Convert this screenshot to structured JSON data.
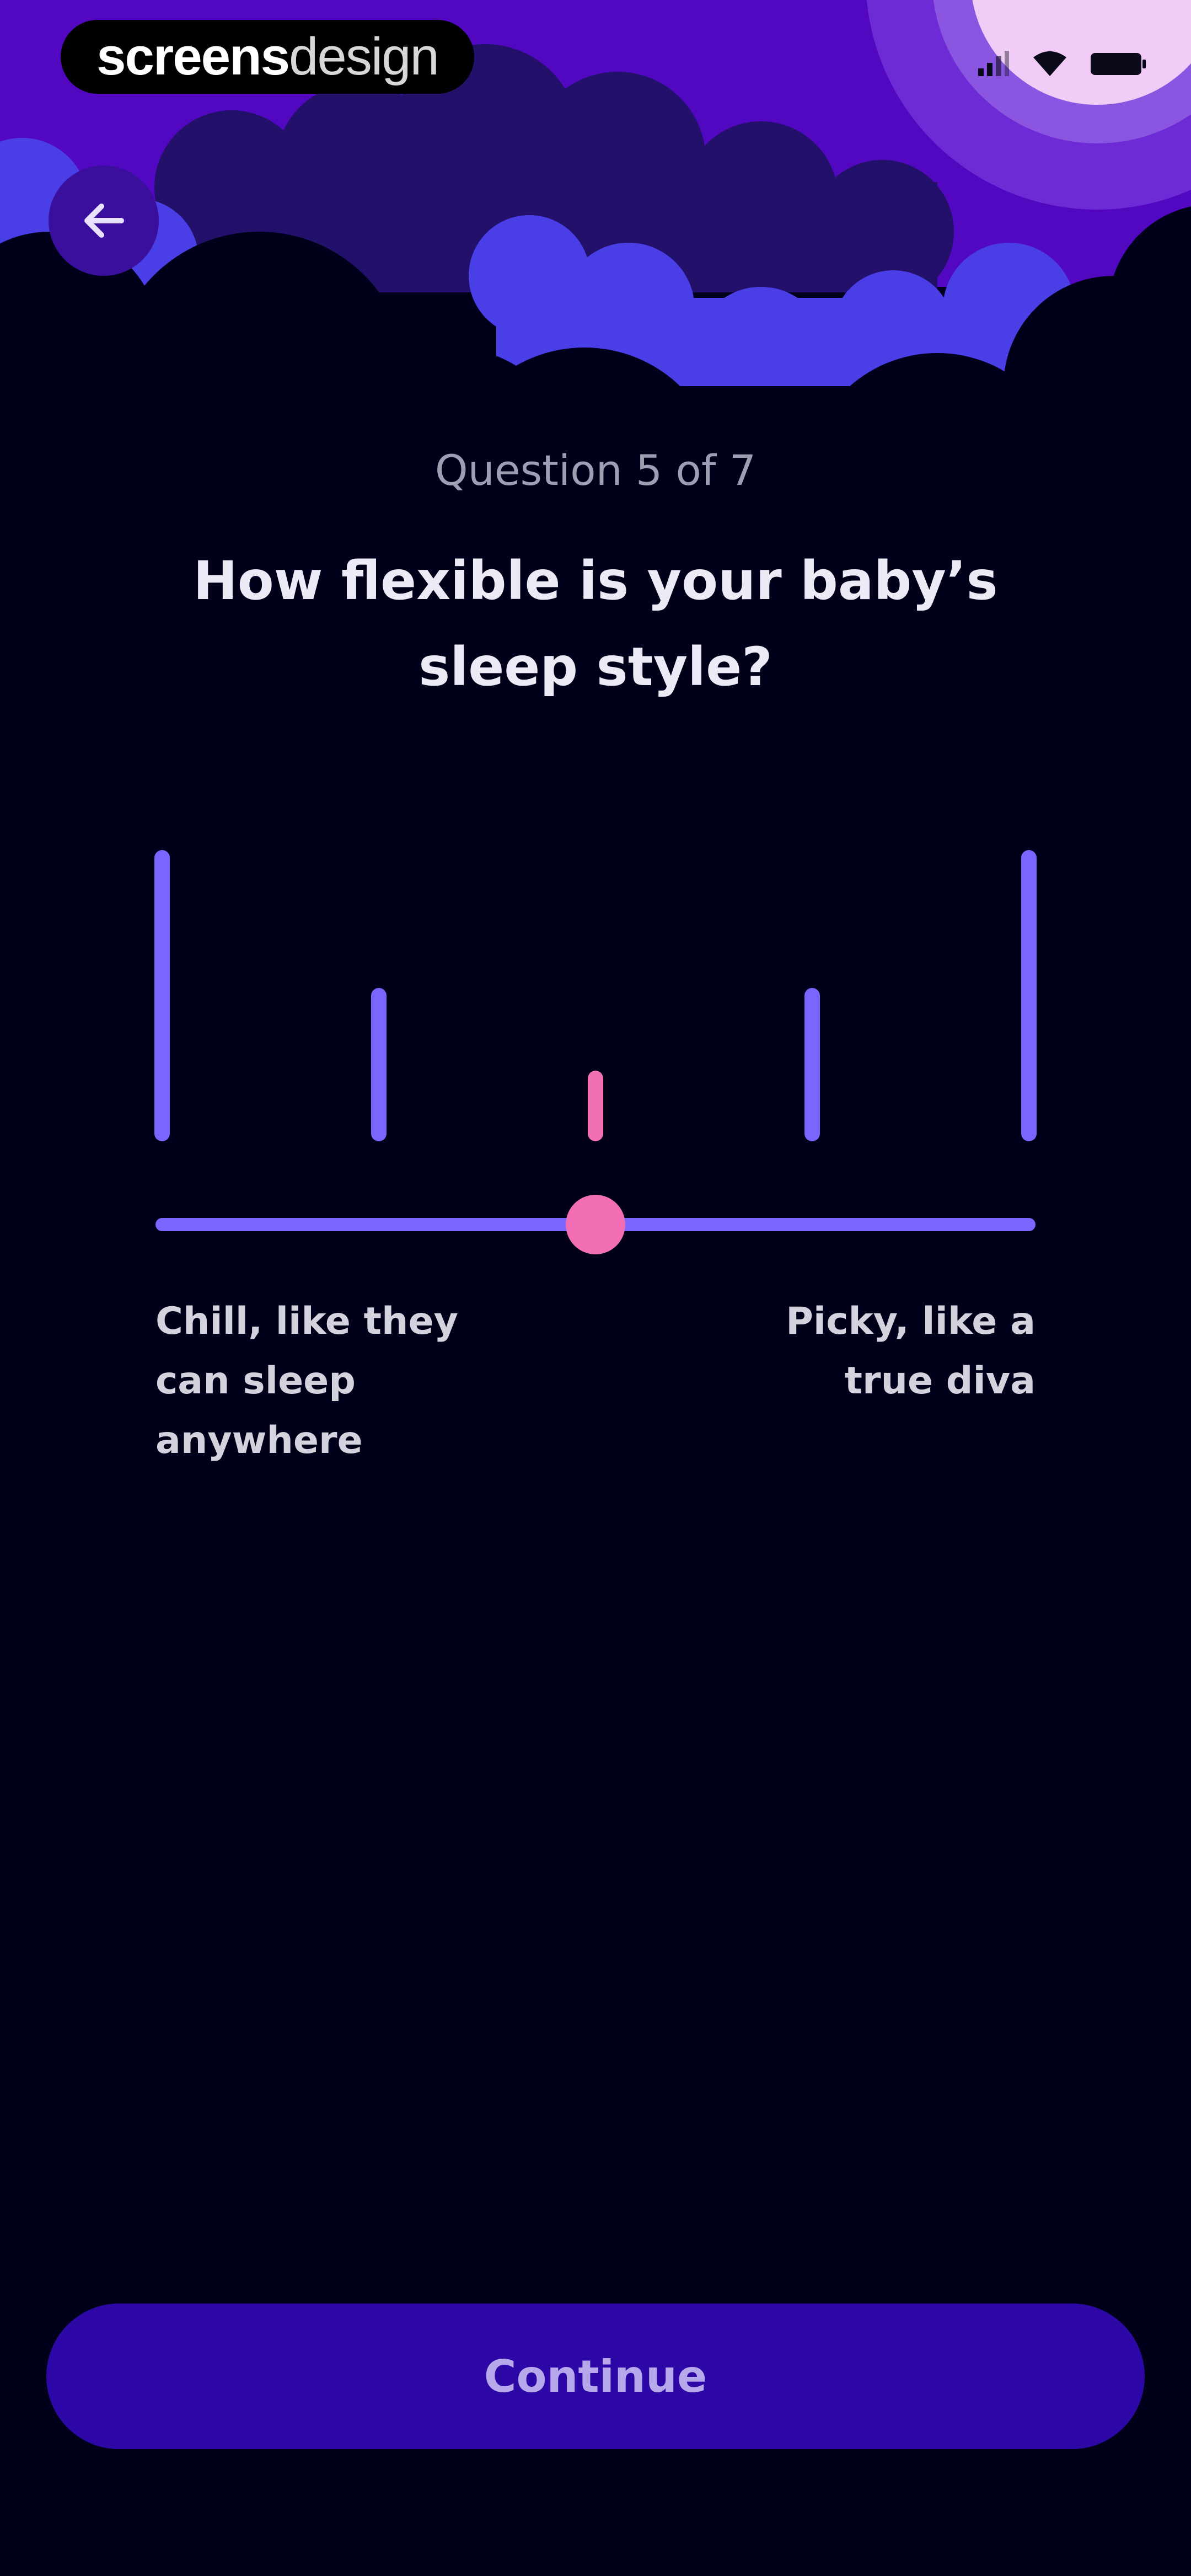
{
  "watermark": {
    "bold_part": "screens",
    "light_part": "design"
  },
  "status_bar": {
    "icons": [
      "signal-icon",
      "wifi-icon",
      "battery-icon"
    ]
  },
  "header": {
    "back_icon": "arrow-left-icon"
  },
  "question": {
    "counter": "Question 5 of 7",
    "title": "How flexible is your baby’s sleep style?"
  },
  "slider": {
    "steps": 5,
    "selected_step": 3,
    "left_label": "Chill, like they can sleep anywhere",
    "right_label": "Picky, like a true diva"
  },
  "footer": {
    "continue_label": "Continue"
  },
  "colors": {
    "background": "#01001a",
    "sky_purple": "#5a08c4",
    "cloud_blue": "#4a3ee6",
    "accent_violet": "#7a66ff",
    "accent_pink": "#f26fb5",
    "button": "#2d08a6"
  }
}
